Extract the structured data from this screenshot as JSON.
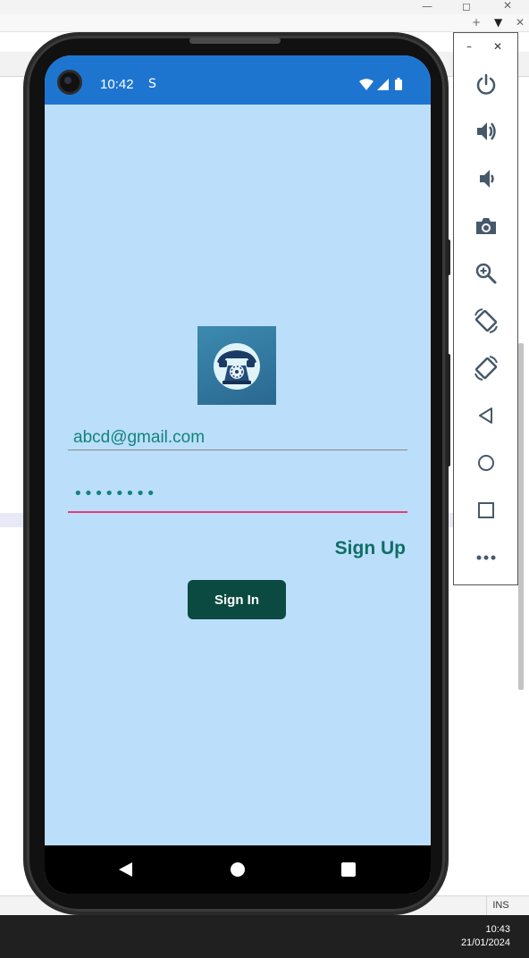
{
  "host_window": {
    "minimize_glyph": "—",
    "maximize_glyph": "◻",
    "close_glyph": "✕",
    "tab_add_glyph": "+",
    "tab_menu_glyph": "▼",
    "tab_close_glyph": "✕",
    "status_ins": "INS"
  },
  "taskbar": {
    "time": "10:43",
    "date": "21/01/2024"
  },
  "phone": {
    "status_bar": {
      "time": "10:42",
      "s_icon_glyph": "S",
      "icons": [
        "wifi-icon",
        "cellular-signal-icon",
        "battery-icon"
      ]
    },
    "app": {
      "logo": "telephone-logo",
      "email_value": "abcd@gmail.com",
      "password_value": "••••••••",
      "signup_label": "Sign Up",
      "signin_label": "Sign In"
    },
    "nav_bar": [
      "back-icon",
      "home-icon",
      "recents-icon"
    ]
  },
  "emulator_panel": {
    "minimize_glyph": "–",
    "close_glyph": "✕",
    "controls": [
      "power-icon",
      "volume-up-icon",
      "volume-down-icon",
      "camera-icon",
      "zoom-icon",
      "rotate-left-icon",
      "rotate-right-icon",
      "back-icon",
      "home-icon",
      "overview-icon",
      "more-icon"
    ]
  },
  "colors": {
    "status_bar": "#1e75d0",
    "screen_background": "#bbdefa",
    "accent_teal": "#12837a",
    "signin_button": "#0a4a40",
    "password_underline": "#e0407a"
  }
}
